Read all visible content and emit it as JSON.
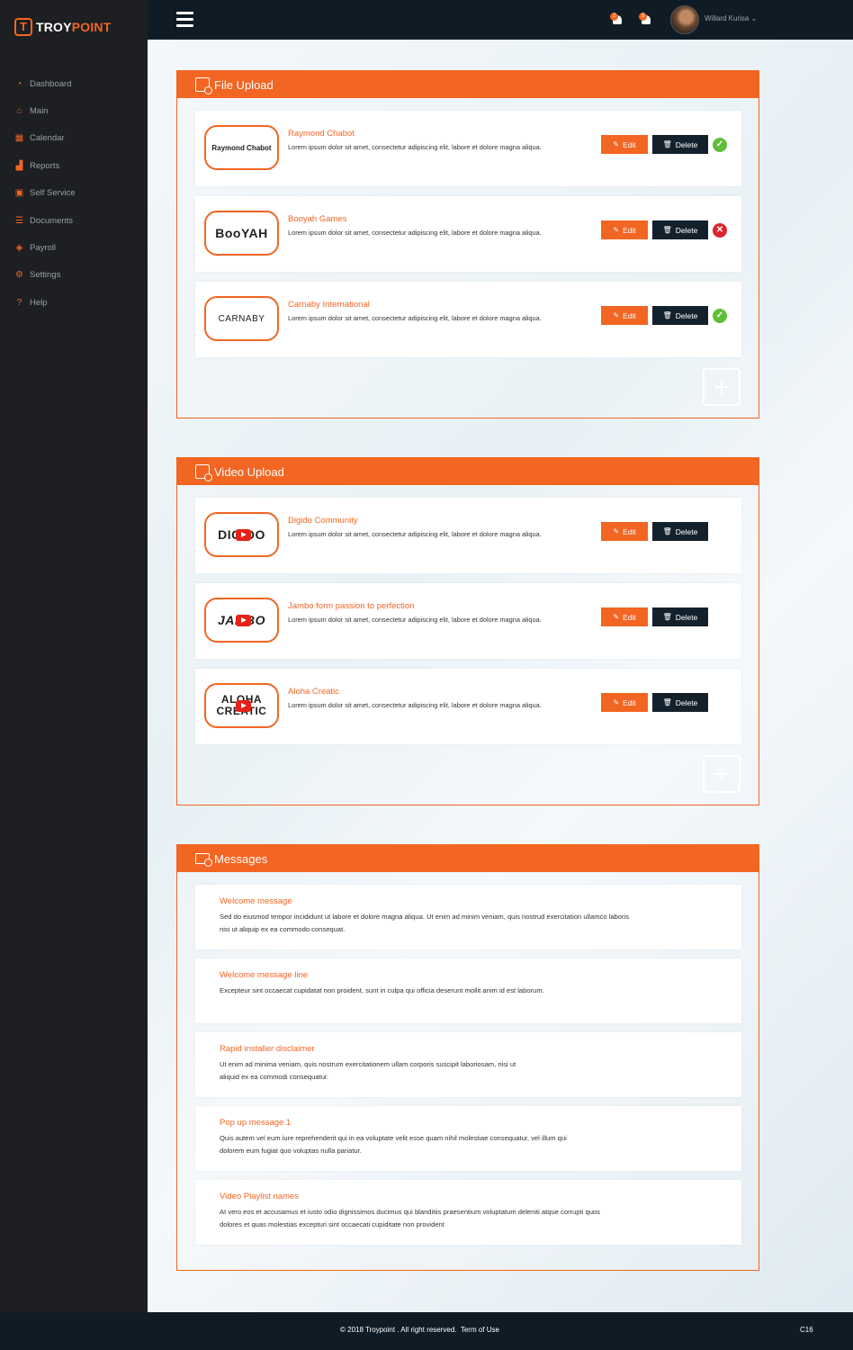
{
  "brand": {
    "mark": "T",
    "text_a": "TROY",
    "text_b": "POINT"
  },
  "sidebar": {
    "items": [
      {
        "label": "Dashboard",
        "icon": "dashboard-icon"
      },
      {
        "label": "Main",
        "icon": "home-icon"
      },
      {
        "label": "Calendar",
        "icon": "calendar-icon"
      },
      {
        "label": "Reports",
        "icon": "chart-icon"
      },
      {
        "label": "Self Service",
        "icon": "self-service-icon"
      },
      {
        "label": "Documents",
        "icon": "documents-icon"
      },
      {
        "label": "Payroll",
        "icon": "payroll-icon"
      },
      {
        "label": "Settings",
        "icon": "gear-icon"
      },
      {
        "label": "Help",
        "icon": "help-icon"
      }
    ]
  },
  "header": {
    "user_name": "Willard Kurisa ⌄",
    "notifications": [
      {
        "count": "2",
        "icon": "users-icon"
      },
      {
        "count": "5",
        "icon": "bell-icon"
      }
    ]
  },
  "file_upload": {
    "title": "File Upload",
    "items": [
      {
        "name": "Raymond Chabot",
        "logo": "Raymond Chabot",
        "desc": "Lorem ipsum dolor sit amet, consectetur adipiscing elit, labore et dolore magna aliqua.",
        "status": "ok"
      },
      {
        "name": "Booyah Games",
        "logo": "BooYAH",
        "desc": "Lorem ipsum dolor sit amet, consectetur adipiscing elit, labore et dolore magna aliqua.",
        "status": "bad"
      },
      {
        "name": "Carnaby International",
        "logo": "CARNABY",
        "desc": "Lorem ipsum dolor sit amet, consectetur adipiscing elit, labore et dolore magna aliqua.",
        "status": "ok"
      }
    ]
  },
  "video_upload": {
    "title": "Video Upload",
    "items": [
      {
        "name": "Digido Community",
        "logo": "DIGIDO",
        "desc": "Lorem ipsum dolor sit amet, consectetur adipiscing elit, labore et dolore magna aliqua."
      },
      {
        "name": "Jambo form passion to perfection",
        "logo": "JAMBO",
        "desc": "Lorem ipsum dolor sit amet, consectetur adipiscing elit, labore et dolore magna aliqua."
      },
      {
        "name": "Aloha Creatic",
        "logo": "ALOHA CREATIC",
        "desc": "Lorem ipsum dolor sit amet, consectetur adipiscing elit, labore et dolore magna aliqua."
      }
    ]
  },
  "buttons": {
    "edit": "Edit",
    "delete": "Delete"
  },
  "messages": {
    "title": "Messages",
    "items": [
      {
        "title": "Welcome message",
        "body": "Sed do eiusmod tempor incididunt ut labore et dolore magna aliqua. Ut enim ad minim veniam, quis nostrud exercitation ullamco laboris nisi ut aliquip ex ea commodo consequat."
      },
      {
        "title": "Welcome message line",
        "body": "Excepteur sint occaecat cupidatat non proident, sunt in culpa qui officia deserunt mollit anim id est laborum."
      },
      {
        "title": "Rapid installer disclaimer",
        "body": "Ut enim ad minima veniam, quis nostrum exercitationem ullam corporis suscipit laboriosam, nisi ut aliquid ex ea commodi consequatur."
      },
      {
        "title": "Pop up message 1",
        "body": "Quis autem vel eum iure reprehenderit qui in ea voluptate velit esse quam nihil molestiae consequatur, vel illum qui dolorem eum fugiat quo voluptas nulla pariatur."
      },
      {
        "title": "Video Playlist names",
        "body": "At vero eos et accusamus et iusto odio dignissimos ducimus qui blanditiis praesentium voluptatum deleniti atque corrupti quos dolores et quas molestias excepturi sint occaecati cupiditate non provident"
      }
    ]
  },
  "footer": {
    "copyright": "© 2018 Troypoint . All right reserved.",
    "terms": "Term of Use",
    "code": "C16"
  },
  "colors": {
    "accent": "#f26522",
    "dark": "#0f1c26",
    "sidebar": "#1d1f22",
    "ok": "#5fbf3a",
    "error": "#d9262e"
  }
}
